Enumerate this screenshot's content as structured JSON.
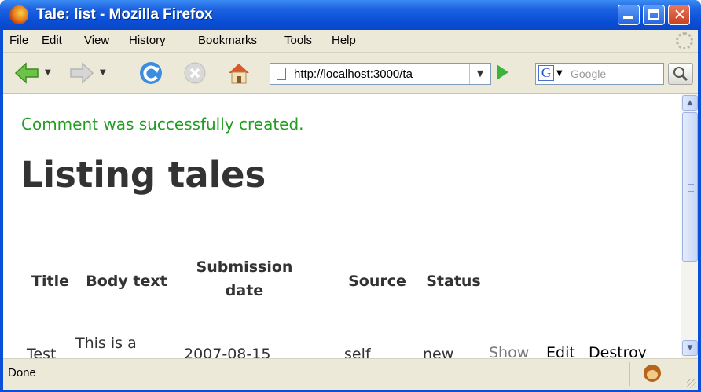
{
  "window": {
    "title": "Tale: list - Mozilla Firefox"
  },
  "menubar": {
    "items": [
      "File",
      "Edit",
      "View",
      "History",
      "Bookmarks",
      "Tools",
      "Help"
    ]
  },
  "navbar": {
    "url": "http://localhost:3000/ta",
    "search_placeholder": "Google",
    "search_engine_icon": "google-g-icon"
  },
  "page": {
    "notice": "Comment was successfully created.",
    "heading": "Listing tales",
    "table": {
      "headers": [
        "Title",
        "Body text",
        "Submission date",
        "Source",
        "Status"
      ],
      "rows": [
        {
          "title": "Test",
          "body_text": "This is a test",
          "submission_date": "2007-08-15",
          "source": "self",
          "status": "new",
          "actions": [
            "Show",
            "Edit",
            "Destroy"
          ]
        }
      ]
    }
  },
  "statusbar": {
    "text": "Done"
  },
  "colors": {
    "notice": "#1f9e1f",
    "titlebar": "#0a4fd8",
    "heading": "#333333"
  }
}
